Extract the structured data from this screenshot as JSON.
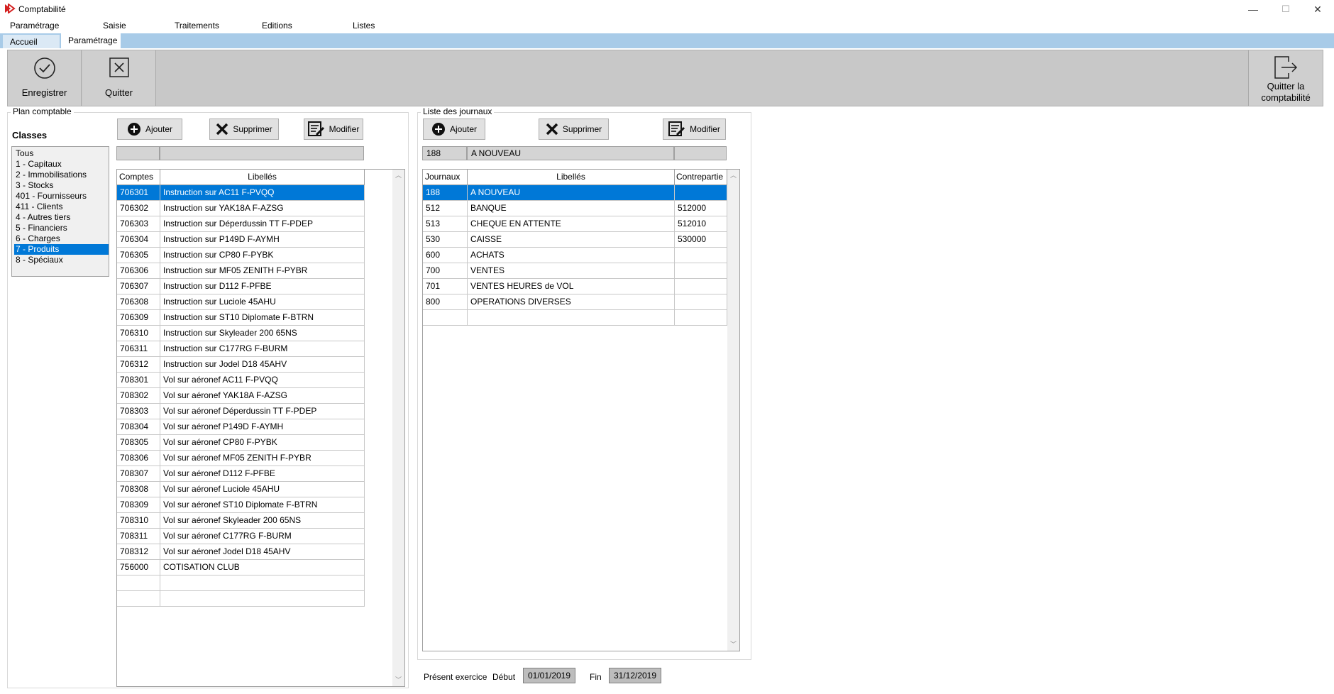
{
  "window": {
    "title": "Comptabilité",
    "minimize": "—",
    "maximize": "☐",
    "close": "✕"
  },
  "menu": [
    "Paramétrage",
    "Saisie",
    "Traitements",
    "Editions",
    "Listes"
  ],
  "tabs": [
    {
      "label": "Accueil",
      "active": false
    },
    {
      "label": "Paramétrage",
      "active": true
    }
  ],
  "toolbar": {
    "save_label": "Enregistrer",
    "quit_label": "Quitter",
    "quit_app_label_1": "Quitter la",
    "quit_app_label_2": "comptabilité"
  },
  "plan": {
    "legend": "Plan comptable",
    "classes_heading": "Classes",
    "add_label": "Ajouter",
    "delete_label": "Supprimer",
    "edit_label": "Modifier",
    "field_code": "",
    "field_label": "",
    "classes": [
      {
        "label": "Tous",
        "selected": false
      },
      {
        "label": "1 - Capitaux",
        "selected": false
      },
      {
        "label": "2 - Immobilisations",
        "selected": false
      },
      {
        "label": "3 - Stocks",
        "selected": false
      },
      {
        "label": "401 - Fournisseurs",
        "selected": false
      },
      {
        "label": "411 - Clients",
        "selected": false
      },
      {
        "label": "4 - Autres tiers",
        "selected": false
      },
      {
        "label": "5 - Financiers",
        "selected": false
      },
      {
        "label": "6 - Charges",
        "selected": false
      },
      {
        "label": "7 - Produits",
        "selected": true
      },
      {
        "label": "8 - Spéciaux",
        "selected": false
      }
    ],
    "columns": [
      "Comptes",
      "Libellés"
    ],
    "rows": [
      {
        "code": "706301",
        "label": "Instruction sur AC11 F-PVQQ",
        "selected": true
      },
      {
        "code": "706302",
        "label": "Instruction sur YAK18A F-AZSG",
        "selected": false
      },
      {
        "code": "706303",
        "label": "Instruction sur Déperdussin TT F-PDEP",
        "selected": false
      },
      {
        "code": "706304",
        "label": "Instruction sur P149D F-AYMH",
        "selected": false
      },
      {
        "code": "706305",
        "label": "Instruction sur CP80 F-PYBK",
        "selected": false
      },
      {
        "code": "706306",
        "label": "Instruction sur MF05 ZENITH F-PYBR",
        "selected": false
      },
      {
        "code": "706307",
        "label": "Instruction sur D112 F-PFBE",
        "selected": false
      },
      {
        "code": "706308",
        "label": "Instruction sur Luciole 45AHU",
        "selected": false
      },
      {
        "code": "706309",
        "label": "Instruction sur ST10 Diplomate F-BTRN",
        "selected": false
      },
      {
        "code": "706310",
        "label": "Instruction sur Skyleader 200 65NS",
        "selected": false
      },
      {
        "code": "706311",
        "label": "Instruction sur C177RG F-BURM",
        "selected": false
      },
      {
        "code": "706312",
        "label": "Instruction sur Jodel D18 45AHV",
        "selected": false
      },
      {
        "code": "708301",
        "label": "Vol sur aéronef AC11 F-PVQQ",
        "selected": false
      },
      {
        "code": "708302",
        "label": "Vol sur aéronef YAK18A F-AZSG",
        "selected": false
      },
      {
        "code": "708303",
        "label": "Vol sur aéronef Déperdussin TT F-PDEP",
        "selected": false
      },
      {
        "code": "708304",
        "label": "Vol sur aéronef P149D F-AYMH",
        "selected": false
      },
      {
        "code": "708305",
        "label": "Vol sur aéronef CP80 F-PYBK",
        "selected": false
      },
      {
        "code": "708306",
        "label": "Vol sur aéronef MF05 ZENITH F-PYBR",
        "selected": false
      },
      {
        "code": "708307",
        "label": "Vol sur aéronef D112 F-PFBE",
        "selected": false
      },
      {
        "code": "708308",
        "label": "Vol sur aéronef Luciole 45AHU",
        "selected": false
      },
      {
        "code": "708309",
        "label": "Vol sur aéronef ST10 Diplomate F-BTRN",
        "selected": false
      },
      {
        "code": "708310",
        "label": "Vol sur aéronef Skyleader 200 65NS",
        "selected": false
      },
      {
        "code": "708311",
        "label": "Vol sur aéronef C177RG F-BURM",
        "selected": false
      },
      {
        "code": "708312",
        "label": "Vol sur aéronef Jodel D18 45AHV",
        "selected": false
      },
      {
        "code": "756000",
        "label": "COTISATION CLUB",
        "selected": false
      },
      {
        "code": "",
        "label": "",
        "selected": false
      },
      {
        "code": "",
        "label": "",
        "selected": false
      }
    ]
  },
  "journaux": {
    "legend": "Liste des journaux",
    "add_label": "Ajouter",
    "delete_label": "Supprimer",
    "edit_label": "Modifier",
    "field_code": "188",
    "field_label": "A NOUVEAU",
    "field_contra": "",
    "columns": [
      "Journaux",
      "Libellés",
      "Contrepartie"
    ],
    "rows": [
      {
        "code": "188",
        "label": "A NOUVEAU",
        "contra": "",
        "selected": true
      },
      {
        "code": "512",
        "label": "BANQUE",
        "contra": "512000",
        "selected": false
      },
      {
        "code": "513",
        "label": "CHEQUE EN ATTENTE",
        "contra": "512010",
        "selected": false
      },
      {
        "code": "530",
        "label": "CAISSE",
        "contra": "530000",
        "selected": false
      },
      {
        "code": "600",
        "label": "ACHATS",
        "contra": "",
        "selected": false
      },
      {
        "code": "700",
        "label": "VENTES",
        "contra": "",
        "selected": false
      },
      {
        "code": "701",
        "label": "VENTES HEURES de VOL",
        "contra": "",
        "selected": false
      },
      {
        "code": "800",
        "label": "OPERATIONS DIVERSES",
        "contra": "",
        "selected": false
      },
      {
        "code": "",
        "label": "",
        "contra": "",
        "selected": false
      }
    ]
  },
  "exercice": {
    "label": "Présent exercice",
    "start_label": "Début",
    "start": "01/01/2019",
    "end_label": "Fin",
    "end": "31/12/2019"
  },
  "colors": {
    "accent": "#0078d7",
    "tabstrip": "#a8cbe8",
    "toolbar": "#c8c8c8"
  }
}
